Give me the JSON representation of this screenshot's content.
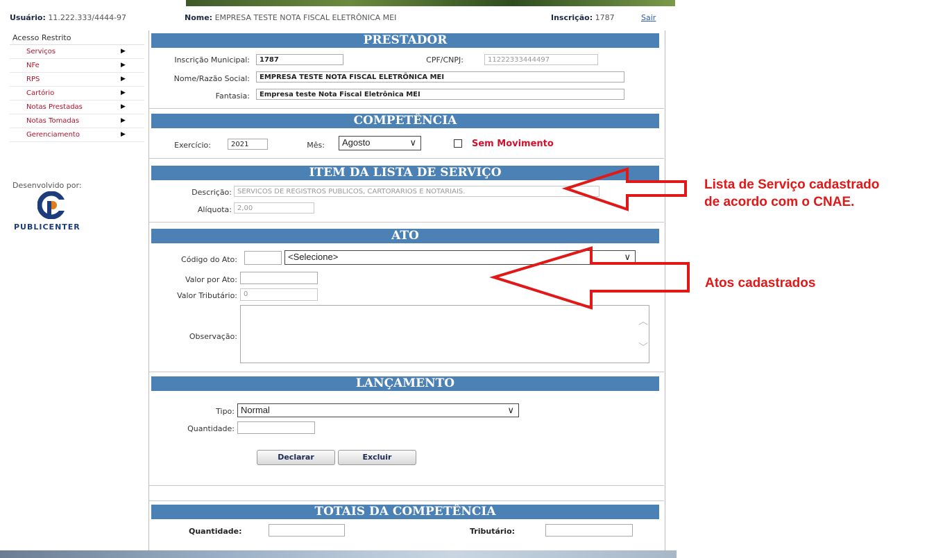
{
  "header": {
    "user_label": "Usuário:",
    "user_value": "11.222.333/4444-97",
    "name_label": "Nome:",
    "name_value": "EMPRESA TESTE NOTA FISCAL ELETRÔNICA MEI",
    "inscricao_label": "Inscrição:",
    "inscricao_value": "1787",
    "logout": "Sair"
  },
  "sidebar": {
    "title": "Acesso Restrito",
    "items": [
      {
        "label": "Serviços"
      },
      {
        "label": "NFe"
      },
      {
        "label": "RPS"
      },
      {
        "label": "Cartório"
      },
      {
        "label": "Notas Prestadas"
      },
      {
        "label": "Notas Tomadas"
      },
      {
        "label": "Gerenciamento"
      }
    ],
    "developer_label": "Desenvolvido por:",
    "developer_name": "PUBLICENTER",
    "accent": "#b0122a"
  },
  "prestador": {
    "title": "PRESTADOR",
    "im_label": "Inscrição Municipal:",
    "im_value": "1787",
    "cpf_label": "CPF/CNPJ:",
    "cpf_value": "11222333444497",
    "razao_label": "Nome/Razão Social:",
    "razao_value": "EMPRESA TESTE NOTA FISCAL ELETRÔNICA MEI",
    "fantasia_label": "Fantasia:",
    "fantasia_value": "Empresa teste Nota Fiscal Eletrônica MEI"
  },
  "competencia": {
    "title": "COMPETÊNCIA",
    "exercicio_label": "Exercício:",
    "exercicio_value": "2021",
    "mes_label": "Mês:",
    "mes_value": "Agosto",
    "sem_movimento": "Sem Movimento"
  },
  "item_lista": {
    "title": "ITEM DA LISTA DE SERVIÇO",
    "descricao_label": "Descrição:",
    "descricao_value": "SERVICOS DE REGISTROS PUBLICOS, CARTORARIOS E NOTARIAIS.",
    "aliquota_label": "Alíquota:",
    "aliquota_value": "2,00"
  },
  "ato": {
    "title": "ATO",
    "codigo_label": "Código do Ato:",
    "codigo_value": "",
    "select_value": "<Selecione>",
    "valor_label": "Valor por Ato:",
    "valor_value": "",
    "tributario_label": "Valor Tributário:",
    "tributario_value": "0",
    "obs_label": "Observação:"
  },
  "lancamento": {
    "title": "LANÇAMENTO",
    "tipo_label": "Tipo:",
    "tipo_value": "Normal",
    "quantidade_label": "Quantidade:",
    "declarar": "Declarar",
    "excluir": "Excluir"
  },
  "totais": {
    "title": "TOTAIS DA COMPETÊNCIA",
    "quantidade_label": "Quantidade:",
    "tributario_label": "Tributário:"
  },
  "annotations": {
    "lista_line1": "Lista de Serviço cadastrado",
    "lista_line2": "de acordo com o CNAE.",
    "atos": "Atos cadastrados",
    "color": "#e01818"
  },
  "colors": {
    "section_header": "#4b81b5"
  }
}
